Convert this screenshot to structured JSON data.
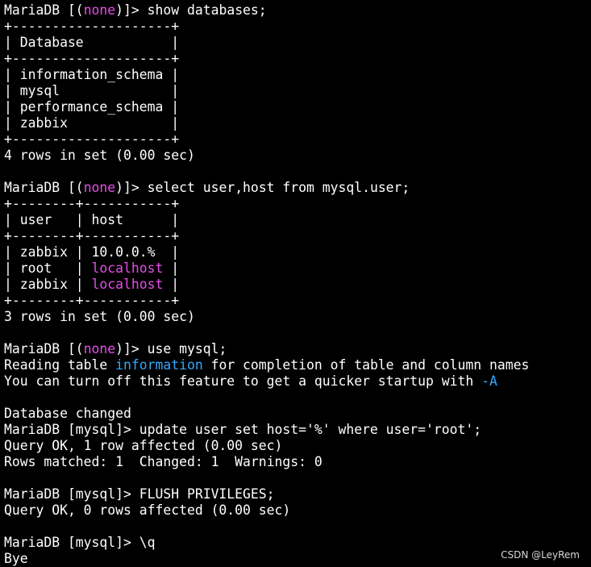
{
  "terminal": {
    "accent_colors": {
      "magenta": "#e84de8",
      "cyan": "#33aaff",
      "text": "#ffffff",
      "background": "#000000"
    },
    "lines": [
      [
        {
          "t": "MariaDB [("
        },
        {
          "t": "none",
          "c": "magenta"
        },
        {
          "t": ")]> show databases;"
        }
      ],
      [
        {
          "t": "+--------------------+"
        }
      ],
      [
        {
          "t": "| Database           |"
        }
      ],
      [
        {
          "t": "+--------------------+"
        }
      ],
      [
        {
          "t": "| information_schema |"
        }
      ],
      [
        {
          "t": "| mysql              |"
        }
      ],
      [
        {
          "t": "| performance_schema |"
        }
      ],
      [
        {
          "t": "| zabbix             |"
        }
      ],
      [
        {
          "t": "+--------------------+"
        }
      ],
      [
        {
          "t": "4 rows in set (0.00 sec)"
        }
      ],
      [
        {
          "t": ""
        }
      ],
      [
        {
          "t": "MariaDB [("
        },
        {
          "t": "none",
          "c": "magenta"
        },
        {
          "t": ")]> select user,host from mysql.user;"
        }
      ],
      [
        {
          "t": "+--------+-----------+"
        }
      ],
      [
        {
          "t": "| user   | host      |"
        }
      ],
      [
        {
          "t": "+--------+-----------+"
        }
      ],
      [
        {
          "t": "| zabbix | 10.0.0.%  |"
        }
      ],
      [
        {
          "t": "| root   | "
        },
        {
          "t": "localhost",
          "c": "magenta"
        },
        {
          "t": " |"
        }
      ],
      [
        {
          "t": "| zabbix | "
        },
        {
          "t": "localhost",
          "c": "magenta"
        },
        {
          "t": " |"
        }
      ],
      [
        {
          "t": "+--------+-----------+"
        }
      ],
      [
        {
          "t": "3 rows in set (0.00 sec)"
        }
      ],
      [
        {
          "t": ""
        }
      ],
      [
        {
          "t": "MariaDB [("
        },
        {
          "t": "none",
          "c": "magenta"
        },
        {
          "t": ")]> use mysql;"
        }
      ],
      [
        {
          "t": "Reading table "
        },
        {
          "t": "information",
          "c": "cyan"
        },
        {
          "t": " for completion of table and column names"
        }
      ],
      [
        {
          "t": "You can turn off this feature to get a quicker startup with "
        },
        {
          "t": "-A",
          "c": "cyan"
        }
      ],
      [
        {
          "t": ""
        }
      ],
      [
        {
          "t": "Database changed"
        }
      ],
      [
        {
          "t": "MariaDB [mysql]> update user set host='%' where user='root';"
        }
      ],
      [
        {
          "t": "Query OK, 1 row affected (0.00 sec)"
        }
      ],
      [
        {
          "t": "Rows matched: 1  Changed: 1  Warnings: 0"
        }
      ],
      [
        {
          "t": ""
        }
      ],
      [
        {
          "t": "MariaDB [mysql]> FLUSH PRIVILEGES;"
        }
      ],
      [
        {
          "t": "Query OK, 0 rows affected (0.00 sec)"
        }
      ],
      [
        {
          "t": ""
        }
      ],
      [
        {
          "t": "MariaDB [mysql]> \\q"
        }
      ],
      [
        {
          "t": "Bye"
        }
      ]
    ]
  },
  "watermark": {
    "text": "CSDN @LeyRem"
  }
}
